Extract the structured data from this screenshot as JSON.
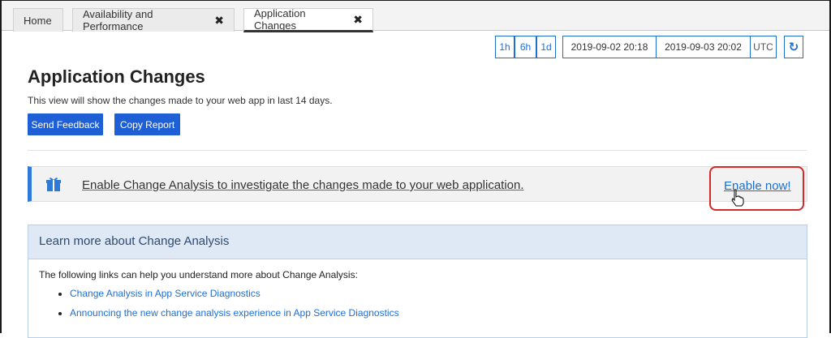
{
  "tabs": [
    {
      "label": "Home"
    },
    {
      "label": "Availability and Performance",
      "close": "✖"
    },
    {
      "label": "Application Changes",
      "close": "✖"
    }
  ],
  "time_controls": {
    "presets": [
      "1h",
      "6h",
      "1d"
    ],
    "start": "2019-09-02 20:18",
    "end": "2019-09-03 20:02",
    "timezone": "UTC",
    "refresh_icon": "↻"
  },
  "page": {
    "title": "Application Changes",
    "subtitle": "This view will show the changes made to your web app in last 14 days.",
    "send_feedback": "Send Feedback",
    "copy_report": "Copy Report"
  },
  "banner": {
    "text": "Enable Change Analysis to investigate the changes made to your web application.",
    "action": "Enable now!",
    "icon": "gift-icon",
    "accent": "#2f7ad6",
    "highlight": "#d62828"
  },
  "learn_more": {
    "heading": "Learn more about Change Analysis",
    "intro": "The following links can help you understand more about Change Analysis:",
    "links": [
      "Change Analysis in App Service Diagnostics",
      "Announcing the new change analysis experience in App Service Diagnostics"
    ]
  }
}
